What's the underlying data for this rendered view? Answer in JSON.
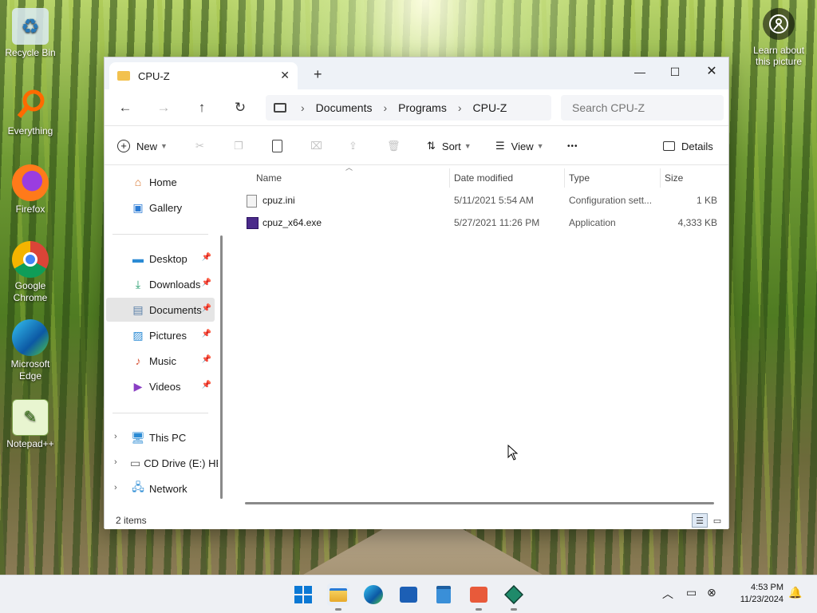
{
  "desktop": {
    "icons": [
      {
        "label": "Recycle Bin"
      },
      {
        "label": "Everything"
      },
      {
        "label": "Firefox"
      },
      {
        "label": "Google Chrome"
      },
      {
        "label": "Microsoft Edge"
      },
      {
        "label": "Notepad++"
      }
    ],
    "spotlight_label": "Learn about this picture"
  },
  "window": {
    "tab_title": "CPU-Z",
    "address": {
      "crumbs": [
        "Documents",
        "Programs",
        "CPU-Z"
      ]
    },
    "search": {
      "placeholder": "Search CPU-Z"
    },
    "toolbar": {
      "new_label": "New",
      "sort_label": "Sort",
      "view_label": "View",
      "more_label": "•••",
      "details_label": "Details"
    },
    "sidebar": {
      "items": [
        {
          "label": "Home"
        },
        {
          "label": "Gallery"
        },
        {
          "label": "Desktop"
        },
        {
          "label": "Downloads"
        },
        {
          "label": "Documents"
        },
        {
          "label": "Pictures"
        },
        {
          "label": "Music"
        },
        {
          "label": "Videos"
        },
        {
          "label": "This PC"
        },
        {
          "label": "CD Drive (E:) HB"
        },
        {
          "label": "Network"
        }
      ]
    },
    "columns": {
      "name": "Name",
      "date": "Date modified",
      "type": "Type",
      "size": "Size"
    },
    "files": [
      {
        "name": "cpuz.ini",
        "date": "5/11/2021 5:54 AM",
        "type": "Configuration sett...",
        "size": "1 KB"
      },
      {
        "name": "cpuz_x64.exe",
        "date": "5/27/2021 11:26 PM",
        "type": "Application",
        "size": "4,333 KB"
      }
    ],
    "status": {
      "item_count": "2 items"
    }
  },
  "taskbar": {
    "clock_time": "4:53 PM",
    "clock_date": "11/23/2024"
  },
  "colors": {
    "accent": "#0067c0",
    "window_bg": "#ffffff",
    "titlebar_bg": "#eef2f7",
    "taskbar_bg": "#eef0f4"
  }
}
